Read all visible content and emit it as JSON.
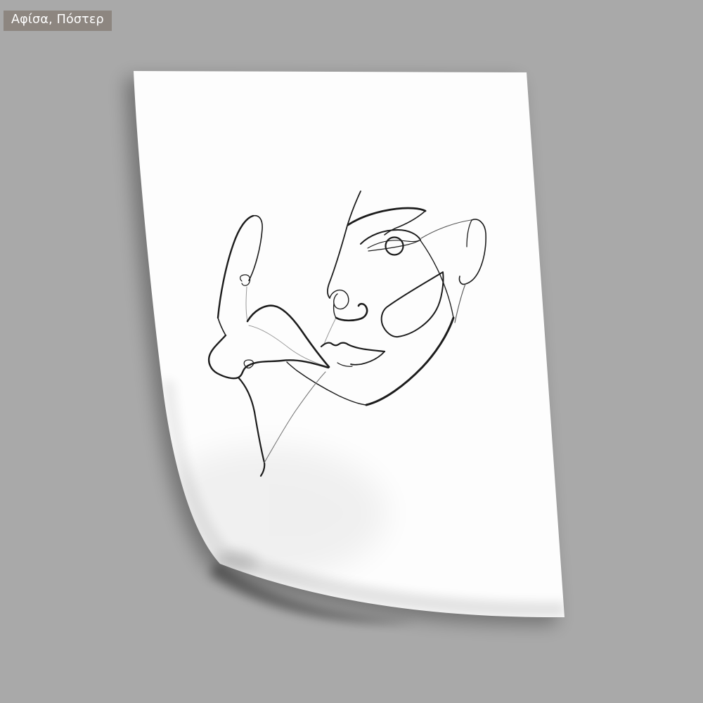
{
  "badge": {
    "label": "Αφίσα, Πόστερ"
  },
  "poster": {
    "description": "White poster sheet with curled bottom-left corner",
    "artwork": "Continuous one-line drawing of a woman's face with eye, brow, nose, lips, cheek and abstract flowing strokes"
  },
  "colors": {
    "bg": "#a9a9a9",
    "badge_bg": "#8d8680",
    "badge_text": "#ffffff",
    "paper": "#fdfdfd",
    "ink": "#1c1c1c"
  }
}
